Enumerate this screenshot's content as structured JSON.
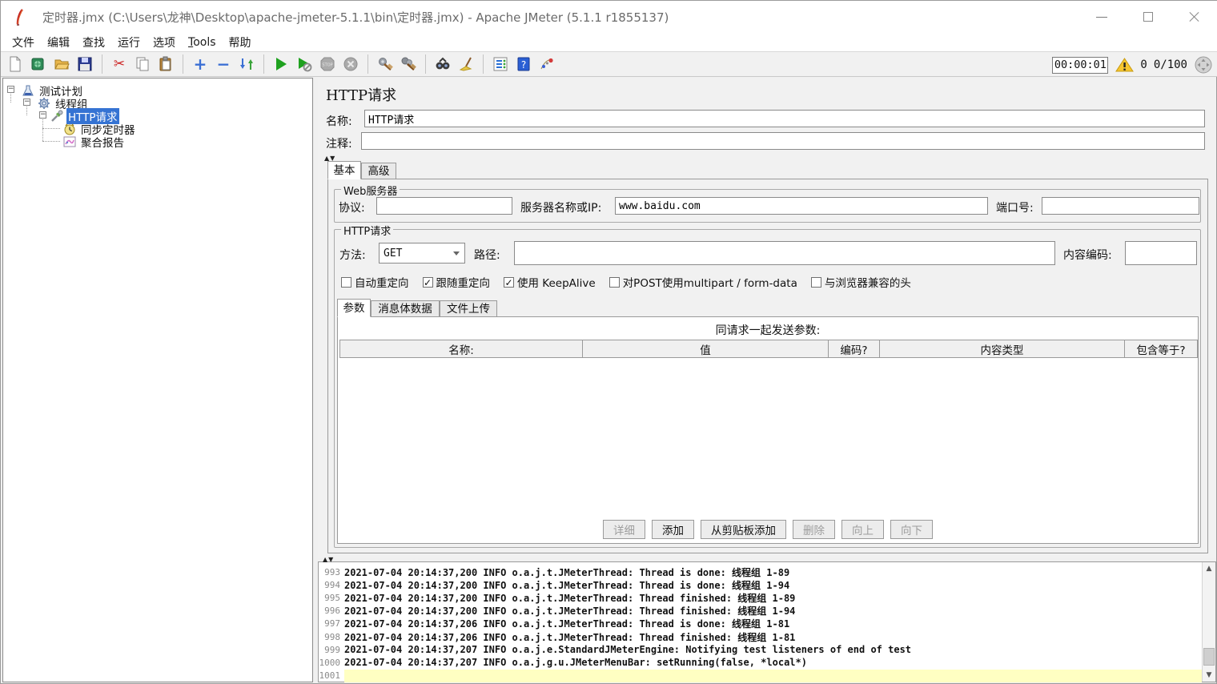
{
  "window": {
    "title": "定时器.jmx (C:\\Users\\龙神\\Desktop\\apache-jmeter-5.1.1\\bin\\定时器.jmx) - Apache JMeter (5.1.1 r1855137)"
  },
  "menu": {
    "items": [
      "文件",
      "编辑",
      "查找",
      "运行",
      "选项",
      "Tools",
      "帮助"
    ]
  },
  "toolbar": {
    "icons": [
      "new-file",
      "templates",
      "open-file",
      "save",
      "cut",
      "copy",
      "paste",
      "expand-all",
      "collapse-all",
      "toggle",
      "start",
      "start-no-timers",
      "stop",
      "shutdown",
      "clear",
      "clear-all",
      "search",
      "clear-search",
      "function-helper",
      "help",
      "jmeter-logo"
    ],
    "elapsed_time": "00:00:01",
    "error_count": "0",
    "thread_count": "0/100"
  },
  "tree": {
    "items": [
      {
        "label": "测试计划",
        "icon": "test-plan"
      },
      {
        "label": "线程组",
        "icon": "thread-group"
      },
      {
        "label": "HTTP请求",
        "icon": "http-request"
      },
      {
        "label": "同步定时器",
        "icon": "sync-timer"
      },
      {
        "label": "聚合报告",
        "icon": "aggregate-report"
      }
    ]
  },
  "editor": {
    "title": "HTTP请求",
    "name_label": "名称:",
    "name_value": "HTTP请求",
    "comment_label": "注释:",
    "comment_value": "",
    "tabs": [
      {
        "label": "基本"
      },
      {
        "label": "高级"
      }
    ],
    "web_server": {
      "legend": "Web服务器",
      "protocol_label": "协议:",
      "protocol_value": "",
      "server_label": "服务器名称或IP:",
      "server_value": "www.baidu.com",
      "port_label": "端口号:",
      "port_value": ""
    },
    "http_request": {
      "legend": "HTTP请求",
      "method_label": "方法:",
      "method_value": "GET",
      "path_label": "路径:",
      "path_value": "",
      "encoding_label": "内容编码:",
      "encoding_value": "",
      "checkboxes": [
        {
          "label": "自动重定向",
          "mark": ""
        },
        {
          "label": "跟随重定向",
          "mark": "✓"
        },
        {
          "label": "使用 KeepAlive",
          "mark": "✓"
        },
        {
          "label": "对POST使用multipart / form-data",
          "mark": ""
        },
        {
          "label": "与浏览器兼容的头",
          "mark": ""
        }
      ],
      "param_tabs": [
        {
          "label": "参数"
        },
        {
          "label": "消息体数据"
        },
        {
          "label": "文件上传"
        }
      ],
      "params_caption": "同请求一起发送参数:",
      "table_columns": [
        {
          "label": "名称:"
        },
        {
          "label": "值"
        },
        {
          "label": "编码?"
        },
        {
          "label": "内容类型"
        },
        {
          "label": "包含等于?"
        }
      ],
      "table_rows": [],
      "buttons": [
        {
          "label": "详细",
          "enabled": false
        },
        {
          "label": "添加",
          "enabled": true
        },
        {
          "label": "从剪贴板添加",
          "enabled": true
        },
        {
          "label": "删除",
          "enabled": false
        },
        {
          "label": "向上",
          "enabled": false
        },
        {
          "label": "向下",
          "enabled": false
        }
      ]
    }
  },
  "log": {
    "lines": [
      {
        "num": "993",
        "text": "2021-07-04 20:14:37,200 INFO o.a.j.t.JMeterThread: Thread is done: 线程组 1-89"
      },
      {
        "num": "994",
        "text": "2021-07-04 20:14:37,200 INFO o.a.j.t.JMeterThread: Thread is done: 线程组 1-94"
      },
      {
        "num": "995",
        "text": "2021-07-04 20:14:37,200 INFO o.a.j.t.JMeterThread: Thread finished: 线程组 1-89"
      },
      {
        "num": "996",
        "text": "2021-07-04 20:14:37,200 INFO o.a.j.t.JMeterThread: Thread finished: 线程组 1-94"
      },
      {
        "num": "997",
        "text": "2021-07-04 20:14:37,206 INFO o.a.j.t.JMeterThread: Thread is done: 线程组 1-81"
      },
      {
        "num": "998",
        "text": "2021-07-04 20:14:37,206 INFO o.a.j.t.JMeterThread: Thread finished: 线程组 1-81"
      },
      {
        "num": "999",
        "text": "2021-07-04 20:14:37,207 INFO o.a.j.e.StandardJMeterEngine: Notifying test listeners of end of test"
      },
      {
        "num": "1000",
        "text": "2021-07-04 20:14:37,207 INFO o.a.j.g.u.JMeterMenuBar: setRunning(false, *local*)"
      },
      {
        "num": "1001",
        "text": ""
      }
    ]
  }
}
